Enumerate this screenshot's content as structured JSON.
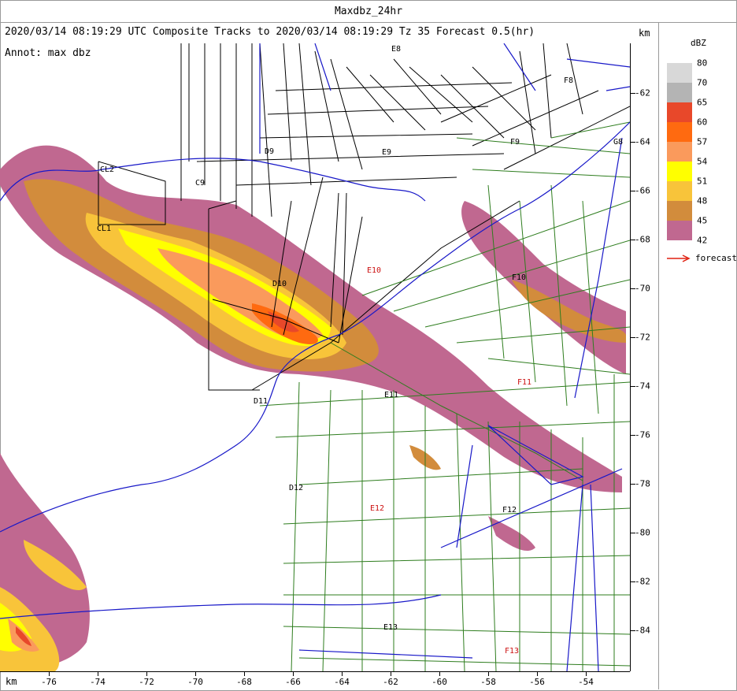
{
  "window": {
    "title": "Maxdbz_24hr"
  },
  "header": {
    "text": "2020/03/14 08:19:29 UTC Composite Tracks to 2020/03/14 08:19:29 Tz 35 Forecast 0.5(hr)",
    "annot": "Annot: max dbz",
    "km_top": "km",
    "km_bottom": "km"
  },
  "x_axis": {
    "ticks": [
      "-76",
      "-74",
      "-72",
      "-70",
      "-68",
      "-66",
      "-64",
      "-62",
      "-60",
      "-58",
      "-56",
      "-54"
    ]
  },
  "y_axis": {
    "ticks": [
      "-62",
      "-64",
      "-66",
      "-68",
      "-70",
      "-72",
      "-74",
      "-76",
      "-78",
      "-80",
      "-82",
      "-84"
    ]
  },
  "legend": {
    "unit": "dBZ",
    "levels": [
      {
        "label": "80",
        "color": "#d8d8d8"
      },
      {
        "label": "70",
        "color": "#b4b4b4"
      },
      {
        "label": "65",
        "color": "#e8482a"
      },
      {
        "label": "60",
        "color": "#ff6a10"
      },
      {
        "label": "57",
        "color": "#fa9a5c"
      },
      {
        "label": "54",
        "color": "#ffff00"
      },
      {
        "label": "51",
        "color": "#f8c43a"
      },
      {
        "label": "48",
        "color": "#d28c3c"
      },
      {
        "label": "45",
        "color": "#c06890"
      },
      {
        "label": "42",
        "color": "#ffffff"
      }
    ],
    "forecast_label": "forecast",
    "forecast_color": "#e02010"
  },
  "colors": {
    "roads_black": "#000000",
    "roads_green": "#2e7d1e",
    "rivers": "#1818c8",
    "labels_red": "#cc1111"
  },
  "storm_labels": [
    {
      "text": "CL2",
      "color": "black"
    },
    {
      "text": "CL1",
      "color": "black"
    },
    {
      "text": "C9",
      "color": "black"
    },
    {
      "text": "D9",
      "color": "black"
    },
    {
      "text": "E9",
      "color": "black"
    },
    {
      "text": "E8",
      "color": "black"
    },
    {
      "text": "F8",
      "color": "black"
    },
    {
      "text": "F9",
      "color": "black"
    },
    {
      "text": "G8",
      "color": "black"
    },
    {
      "text": "D10",
      "color": "black"
    },
    {
      "text": "E10",
      "color": "red"
    },
    {
      "text": "F10",
      "color": "black"
    },
    {
      "text": "D11",
      "color": "black"
    },
    {
      "text": "E11",
      "color": "black"
    },
    {
      "text": "F11",
      "color": "red"
    },
    {
      "text": "D12",
      "color": "black"
    },
    {
      "text": "E12",
      "color": "red"
    },
    {
      "text": "F12",
      "color": "black"
    },
    {
      "text": "E13",
      "color": "black"
    },
    {
      "text": "F13",
      "color": "red"
    }
  ]
}
